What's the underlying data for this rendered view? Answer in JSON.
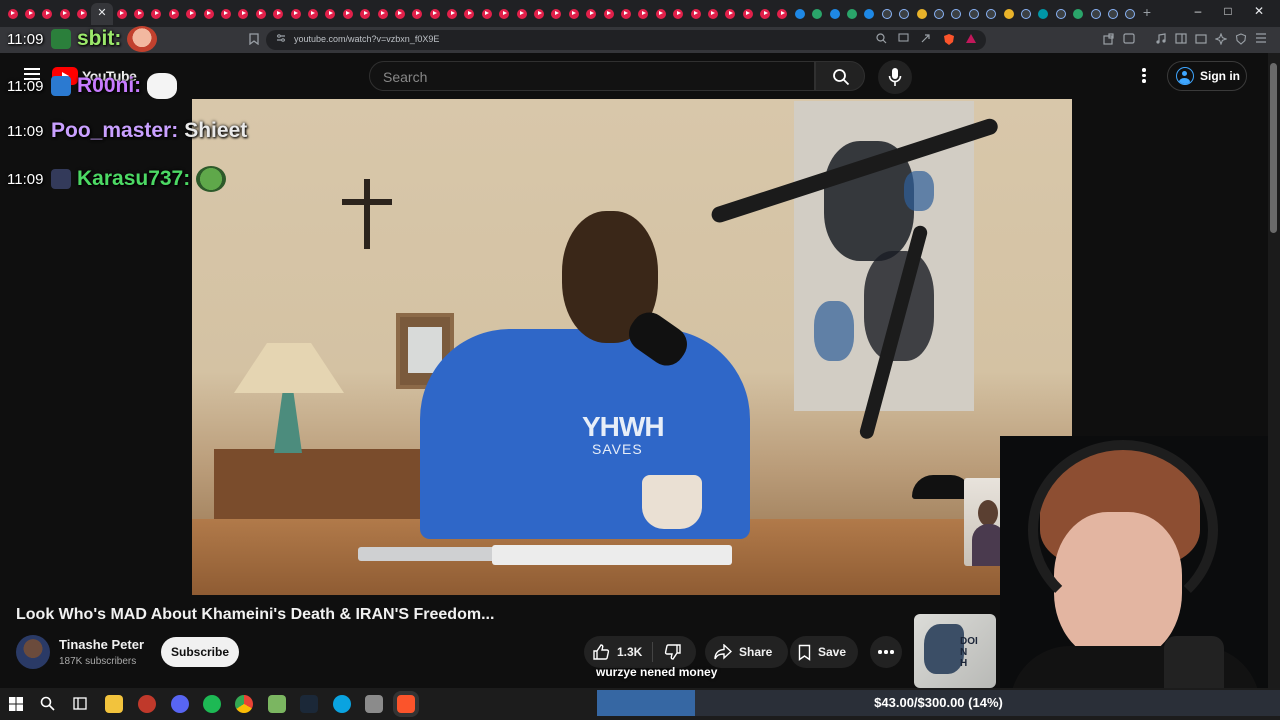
{
  "browser": {
    "url": "youtube.com/watch?v=vzbxn_f0X9E",
    "active_tab_close": "✕",
    "new_tab": "+",
    "window_controls": {
      "minimize": "–",
      "maximize": "□",
      "close": "✕"
    }
  },
  "youtube": {
    "logo_text": "YouTube",
    "search_placeholder": "Search",
    "sign_in": "Sign in",
    "video": {
      "title": "Look Who's MAD About Khameini's Death & IRAN'S Freedom...",
      "hoodie_text_top": "YHWH",
      "hoodie_text_bottom": "SAVES",
      "channel": "Tinashe Peter",
      "subscribers": "187K subscribers",
      "subscribe_label": "Subscribe",
      "likes": "1.3K",
      "share_label": "Share",
      "save_label": "Save"
    },
    "recommended_thumb_text": "DOI\nN\nH"
  },
  "chat": [
    {
      "time": "11:09",
      "user": "sbit:",
      "user_color": "#9be86a",
      "message": "",
      "badges": [
        "#2b7f3b"
      ],
      "emote": true
    },
    {
      "time": "11:09",
      "user": "R00ni:",
      "user_color": "#c77bff",
      "message": "",
      "badges": [
        "#2b7ad1"
      ],
      "emote": true
    },
    {
      "time": "11:09",
      "user": "Poo_master:",
      "user_color": "#c9a0ff",
      "message": "Shieet",
      "badges": [],
      "emote": false
    },
    {
      "time": "11:09",
      "user": "Karasu737:",
      "user_color": "#4cd964",
      "message": "",
      "badges": [
        "#333a5a"
      ],
      "emote": true
    }
  ],
  "overlay": {
    "tts_text": "wurzye nened money",
    "donation_goal": {
      "text": "$43.00/$300.00 (14%)",
      "raised": 43.0,
      "goal": 300.0,
      "percent": 14,
      "fill_color": "#3667a3"
    }
  },
  "colors": {
    "youtube_red": "#ff0000",
    "accent_blue": "#3ea6ff",
    "page_bg": "#0f0f0f"
  }
}
